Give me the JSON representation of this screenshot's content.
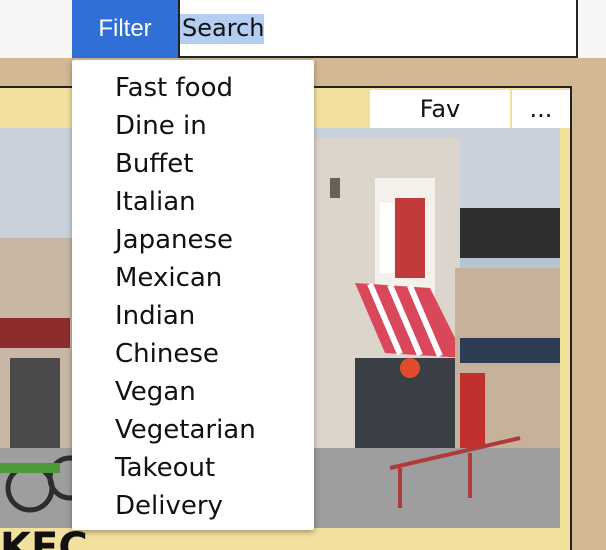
{
  "toolbar": {
    "filter_label": "Filter",
    "search_value": "Search"
  },
  "filter_menu": {
    "items": [
      {
        "label": "Fast food"
      },
      {
        "label": "Dine in"
      },
      {
        "label": "Buffet"
      },
      {
        "label": "Italian"
      },
      {
        "label": "Japanese"
      },
      {
        "label": "Mexican"
      },
      {
        "label": "Indian"
      },
      {
        "label": "Chinese"
      },
      {
        "label": "Vegan"
      },
      {
        "label": "Vegetarian"
      },
      {
        "label": "Takeout"
      },
      {
        "label": "Delivery"
      }
    ]
  },
  "card": {
    "tabs": {
      "fav_label": "Fav",
      "more_label": "..."
    },
    "title": "KFC"
  },
  "colors": {
    "filter_button": "#2f6fd6",
    "card_background": "#f2e09d",
    "outer_background": "#d2b893",
    "selection": "#b3cdf3"
  }
}
